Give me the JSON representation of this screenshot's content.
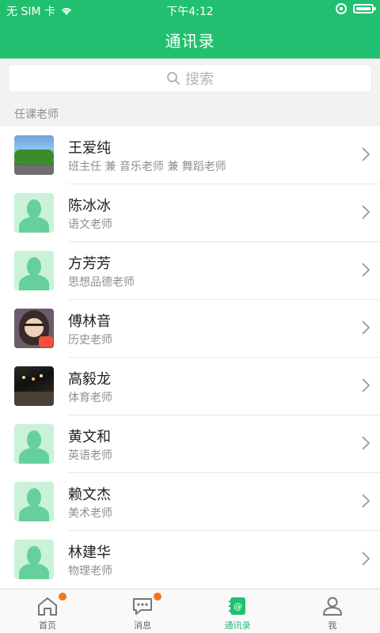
{
  "status_bar": {
    "carrier": "无 SIM 卡",
    "time": "下午4:12"
  },
  "header": {
    "title": "通讯录"
  },
  "search": {
    "placeholder": "搜索"
  },
  "section": {
    "label": "任课老师"
  },
  "contacts": [
    {
      "name": "王爱纯",
      "role": "班主任 兼 音乐老师 兼 舞蹈老师",
      "avatar": "photo-trees"
    },
    {
      "name": "陈冰冰",
      "role": "语文老师",
      "avatar": "default-person-icon"
    },
    {
      "name": "方芳芳",
      "role": "思想品德老师",
      "avatar": "default-person-icon"
    },
    {
      "name": "傅林音",
      "role": "历史老师",
      "avatar": "photo-cartoon-girl"
    },
    {
      "name": "高毅龙",
      "role": "体育老师",
      "avatar": "photo-night-street"
    },
    {
      "name": "黄文和",
      "role": "英语老师",
      "avatar": "default-person-icon"
    },
    {
      "name": "赖文杰",
      "role": "美术老师",
      "avatar": "default-person-icon"
    },
    {
      "name": "林建华",
      "role": "物理老师",
      "avatar": "default-person-icon"
    }
  ],
  "tabbar": {
    "items": [
      {
        "label": "首页",
        "icon": "home-icon",
        "badge": true
      },
      {
        "label": "消息",
        "icon": "chat-bubble-icon",
        "badge": true
      },
      {
        "label": "通讯录",
        "icon": "address-book-icon",
        "active": true
      },
      {
        "label": "我",
        "icon": "person-icon"
      }
    ]
  },
  "colors": {
    "brand": "#21c070",
    "badge": "#f2751e"
  }
}
